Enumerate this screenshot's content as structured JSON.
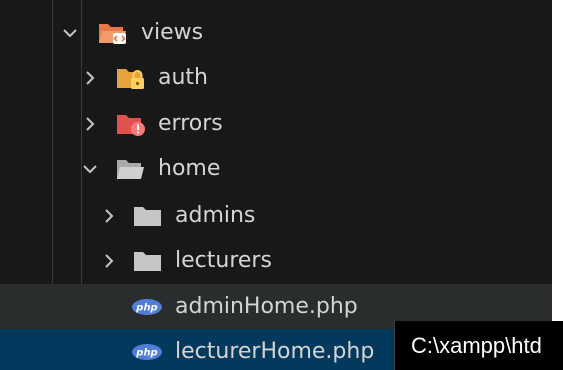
{
  "tree": {
    "items": [
      {
        "label": "views",
        "state": "expanded",
        "icon": "views-folder-open-icon"
      },
      {
        "label": "auth",
        "state": "collapsed",
        "icon": "auth-folder-icon"
      },
      {
        "label": "errors",
        "state": "collapsed",
        "icon": "errors-folder-icon"
      },
      {
        "label": "home",
        "state": "expanded",
        "icon": "folder-open-icon"
      },
      {
        "label": "admins",
        "state": "collapsed",
        "icon": "folder-icon"
      },
      {
        "label": "lecturers",
        "state": "collapsed",
        "icon": "folder-icon"
      },
      {
        "label": "adminHome.php",
        "icon": "php-file-icon"
      },
      {
        "label": "lecturerHome.php",
        "icon": "php-file-icon"
      }
    ]
  },
  "tooltip": {
    "text": "C:\\xampp\\htd"
  },
  "colors": {
    "background": "#181818",
    "hover": "#2a2d2e",
    "selected": "#04395e",
    "views_folder": "#e8784a",
    "auth_folder": "#e6a23c",
    "errors_folder": "#e0524f",
    "plain_folder": "#c5c5c5",
    "php_badge": "#4f7dd8"
  }
}
